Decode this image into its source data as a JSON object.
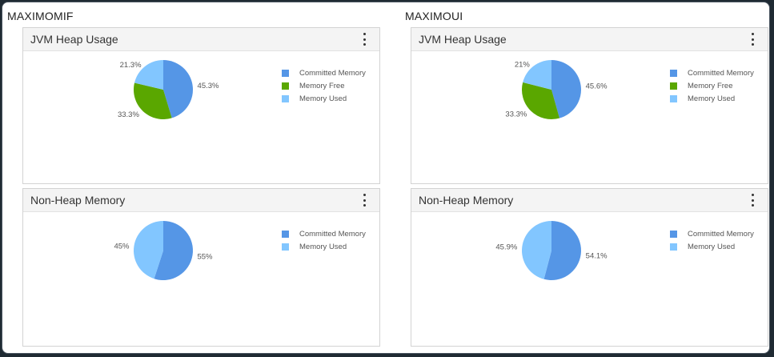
{
  "colors": {
    "committed": "#5596e6",
    "free": "#5aa700",
    "used": "#82c6ff",
    "label": "#555555"
  },
  "groups": [
    {
      "title": "MAXIMOMIF",
      "jvm": {
        "title": "JVM Heap Usage",
        "menu_icon": "kebab-menu-icon",
        "legend": [
          "Committed Memory",
          "Memory Free",
          "Memory Used"
        ],
        "chart_data": {
          "type": "pie",
          "labels": [
            "Committed Memory",
            "Memory Free",
            "Memory Used"
          ],
          "values": [
            45.3,
            33.3,
            21.3
          ],
          "value_labels": [
            "45.3%",
            "33.3%",
            "21.3%"
          ]
        }
      },
      "nonheap": {
        "title": "Non-Heap Memory",
        "menu_icon": "kebab-menu-icon",
        "legend": [
          "Committed Memory",
          "Memory Used"
        ],
        "chart_data": {
          "type": "pie",
          "labels": [
            "Committed Memory",
            "Memory Used"
          ],
          "values": [
            55,
            45
          ],
          "value_labels": [
            "55%",
            "45%"
          ]
        }
      }
    },
    {
      "title": "MAXIMOUI",
      "jvm": {
        "title": "JVM Heap Usage",
        "menu_icon": "kebab-menu-icon",
        "legend": [
          "Committed Memory",
          "Memory Free",
          "Memory Used"
        ],
        "chart_data": {
          "type": "pie",
          "labels": [
            "Committed Memory",
            "Memory Free",
            "Memory Used"
          ],
          "values": [
            45.6,
            33.3,
            21
          ],
          "value_labels": [
            "45.6%",
            "33.3%",
            "21%"
          ]
        }
      },
      "nonheap": {
        "title": "Non-Heap Memory",
        "menu_icon": "kebab-menu-icon",
        "legend": [
          "Committed Memory",
          "Memory Used"
        ],
        "chart_data": {
          "type": "pie",
          "labels": [
            "Committed Memory",
            "Memory Used"
          ],
          "values": [
            54.1,
            45.9
          ],
          "value_labels": [
            "54.1%",
            "45.9%"
          ]
        }
      }
    }
  ]
}
